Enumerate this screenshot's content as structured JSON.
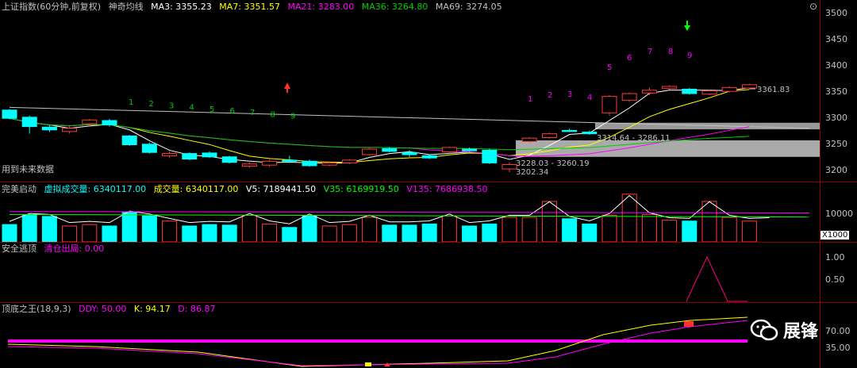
{
  "main": {
    "title": "上证指数(60分钟,前复权)",
    "indicator": "神奇均线",
    "ma": [
      {
        "label": "MA3: 3355.23",
        "color": "#ffffff"
      },
      {
        "label": "MA7: 3351.57",
        "color": "#ffff00"
      },
      {
        "label": "MA21: 3283.00",
        "color": "#ff00ff"
      },
      {
        "label": "MA36: 3264.80",
        "color": "#00cc00"
      },
      {
        "label": "MA69: 3274.05",
        "color": "#c0c0c0"
      }
    ],
    "note": "用到未来数据",
    "y_ticks": [
      "3500",
      "3450",
      "3400",
      "3350",
      "3300",
      "3250",
      "3200"
    ],
    "annotations": {
      "last": "3361.83",
      "zone_high": "3314.64 - 3286.11",
      "zone_low": "3228.03 - 3260.19",
      "low": "3202.34"
    },
    "sequence_left": [
      "1",
      "2",
      "3",
      "4",
      "5",
      "6",
      "7",
      "8",
      "9"
    ],
    "sequence_right": [
      "1",
      "2",
      "3",
      "4",
      "5",
      "6",
      "7",
      "8",
      "9"
    ]
  },
  "volume": {
    "title": "完美启动",
    "items": [
      {
        "label": "虚拟成交量: 6340117.00",
        "color": "#00ffff"
      },
      {
        "label": "成交量: 6340117.00",
        "color": "#ffff00"
      },
      {
        "label": "V5: 7189441.50",
        "color": "#ffffff"
      },
      {
        "label": "V35: 6169919.50",
        "color": "#00ff00"
      },
      {
        "label": "V135: 7686938.50",
        "color": "#ff00ff"
      }
    ],
    "y_tick": "10000",
    "unit": "X1000"
  },
  "escape": {
    "title": "安全逃顶",
    "items": [
      {
        "label": "清仓出局: 0.00",
        "color": "#ff00ff"
      }
    ],
    "y_ticks": [
      "1.00",
      "0.50"
    ]
  },
  "king": {
    "title": "顶底之王(18,9,3)",
    "items": [
      {
        "label": "DDY: 50.00",
        "color": "#ff00ff"
      },
      {
        "label": "K: 94.17",
        "color": "#ffff00"
      },
      {
        "label": "D: 86.87",
        "color": "#ff00ff"
      }
    ],
    "y_ticks": [
      "70.00",
      "35.00"
    ]
  },
  "watermark": "展锋",
  "chart_data": {
    "type": "candlestick",
    "title": "上证指数(60分钟,前复权)",
    "ylim": [
      3185,
      3515
    ],
    "candles": [
      {
        "o": 3315,
        "c": 3300,
        "h": 3317,
        "l": 3298
      },
      {
        "o": 3302,
        "c": 3285,
        "h": 3305,
        "l": 3272
      },
      {
        "o": 3284,
        "c": 3279,
        "h": 3288,
        "l": 3275
      },
      {
        "o": 3276,
        "c": 3282,
        "h": 3286,
        "l": 3272
      },
      {
        "o": 3290,
        "c": 3297,
        "h": 3299,
        "l": 3286
      },
      {
        "o": 3296,
        "c": 3288,
        "h": 3299,
        "l": 3285
      },
      {
        "o": 3268,
        "c": 3252,
        "h": 3270,
        "l": 3250
      },
      {
        "o": 3253,
        "c": 3238,
        "h": 3256,
        "l": 3236
      },
      {
        "o": 3232,
        "c": 3236,
        "h": 3240,
        "l": 3228
      },
      {
        "o": 3236,
        "c": 3226,
        "h": 3238,
        "l": 3224
      },
      {
        "o": 3237,
        "c": 3230,
        "h": 3240,
        "l": 3228
      },
      {
        "o": 3230,
        "c": 3220,
        "h": 3232,
        "l": 3218
      },
      {
        "o": 3213,
        "c": 3217,
        "h": 3220,
        "l": 3210
      },
      {
        "o": 3215,
        "c": 3222,
        "h": 3225,
        "l": 3212
      },
      {
        "o": 3224,
        "c": 3222,
        "h": 3232,
        "l": 3219
      },
      {
        "o": 3222,
        "c": 3214,
        "h": 3225,
        "l": 3212
      },
      {
        "o": 3215,
        "c": 3219,
        "h": 3222,
        "l": 3213
      },
      {
        "o": 3219,
        "c": 3224,
        "h": 3226,
        "l": 3217
      },
      {
        "o": 3234,
        "c": 3244,
        "h": 3246,
        "l": 3232
      },
      {
        "o": 3245,
        "c": 3240,
        "h": 3248,
        "l": 3238
      },
      {
        "o": 3238,
        "c": 3234,
        "h": 3242,
        "l": 3230
      },
      {
        "o": 3232,
        "c": 3228,
        "h": 3235,
        "l": 3226
      },
      {
        "o": 3239,
        "c": 3247,
        "h": 3249,
        "l": 3236
      },
      {
        "o": 3244,
        "c": 3241,
        "h": 3247,
        "l": 3239
      },
      {
        "o": 3242,
        "c": 3219,
        "h": 3245,
        "l": 3217
      },
      {
        "o": 3208,
        "c": 3216,
        "h": 3220,
        "l": 3202
      },
      {
        "o": 3258,
        "c": 3264,
        "h": 3266,
        "l": 3256
      },
      {
        "o": 3265,
        "c": 3272,
        "h": 3274,
        "l": 3263
      },
      {
        "o": 3278,
        "c": 3276,
        "h": 3281,
        "l": 3275
      },
      {
        "o": 3275,
        "c": 3272,
        "h": 3278,
        "l": 3270
      },
      {
        "o": 3310,
        "c": 3340,
        "h": 3342,
        "l": 3305
      },
      {
        "o": 3333,
        "c": 3345,
        "h": 3347,
        "l": 3330
      },
      {
        "o": 3346,
        "c": 3351,
        "h": 3356,
        "l": 3342
      },
      {
        "o": 3354,
        "c": 3358,
        "h": 3360,
        "l": 3352
      },
      {
        "o": 3353,
        "c": 3345,
        "h": 3355,
        "l": 3343
      },
      {
        "o": 3344,
        "c": 3350,
        "h": 3352,
        "l": 3342
      },
      {
        "o": 3349,
        "c": 3356,
        "h": 3358,
        "l": 3347
      },
      {
        "o": 3355,
        "c": 3361,
        "h": 3363,
        "l": 3353
      }
    ],
    "volume_labels": [
      "10000"
    ],
    "volume": [
      60,
      92,
      88,
      55,
      60,
      55,
      102,
      90,
      72,
      55,
      60,
      58,
      92,
      62,
      50,
      90,
      55,
      60,
      85,
      58,
      58,
      62,
      90,
      55,
      62,
      85,
      85,
      140,
      80,
      62,
      92,
      165,
      95,
      75,
      72,
      140,
      85,
      72,
      75
    ]
  }
}
